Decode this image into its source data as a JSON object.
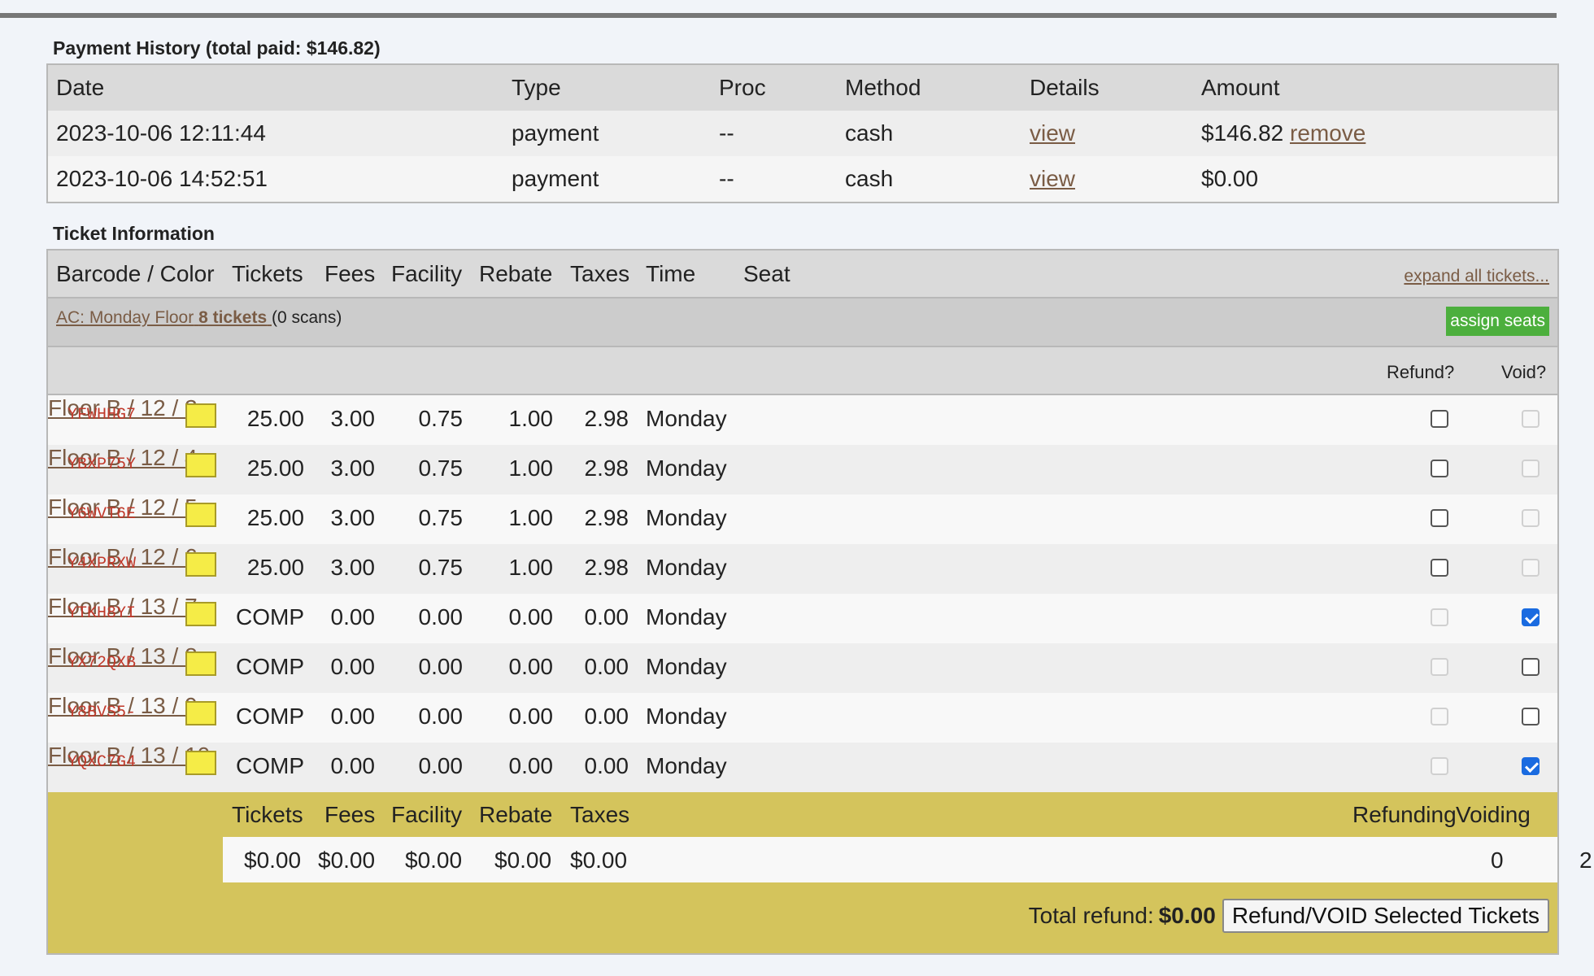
{
  "payment_history": {
    "title": "Payment History (total paid: $146.82)",
    "headers": [
      "Date",
      "Type",
      "Proc",
      "Method",
      "Details",
      "Amount"
    ],
    "rows": [
      {
        "date": "2023-10-06 12:11:44",
        "type": "payment",
        "proc": "--",
        "method": "cash",
        "details": "view",
        "amount": "$146.82",
        "action": "remove"
      },
      {
        "date": "2023-10-06 14:52:51",
        "type": "payment",
        "proc": "--",
        "method": "cash",
        "details": "view",
        "amount": "$0.00",
        "action": ""
      }
    ]
  },
  "ticket_info": {
    "title": "Ticket Information",
    "headers": [
      "Barcode / Color",
      "Tickets",
      "Fees",
      "Facility",
      "Rebate",
      "Taxes",
      "Time",
      "Seat"
    ],
    "expand_link": "expand all tickets...",
    "group": {
      "name": "AC: Monday Floor",
      "count": "8 tickets",
      "scans": "(0 scans)"
    },
    "assign_button": "assign seats",
    "refund_label": "Refund?",
    "void_label": "Void?",
    "swatch_color": "#f5ec47",
    "tickets": [
      {
        "barcode": "YFWHHG7",
        "tickets": "25.00",
        "fees": "3.00",
        "facility": "0.75",
        "rebate": "1.00",
        "taxes": "2.98",
        "time": "Monday",
        "seat": "Floor B / 12 / 3",
        "refund": "unchecked",
        "void": "disabled"
      },
      {
        "barcode": "YBXP75Y",
        "tickets": "25.00",
        "fees": "3.00",
        "facility": "0.75",
        "rebate": "1.00",
        "taxes": "2.98",
        "time": "Monday",
        "seat": "Floor B / 12 / 4",
        "refund": "unchecked",
        "void": "disabled"
      },
      {
        "barcode": "Y6WVT6E",
        "tickets": "25.00",
        "fees": "3.00",
        "facility": "0.75",
        "rebate": "1.00",
        "taxes": "2.98",
        "time": "Monday",
        "seat": "Floor B / 12 / 5",
        "refund": "unchecked",
        "void": "disabled"
      },
      {
        "barcode": "Y4XPRXW",
        "tickets": "25.00",
        "fees": "3.00",
        "facility": "0.75",
        "rebate": "1.00",
        "taxes": "2.98",
        "time": "Monday",
        "seat": "Floor B / 12 / 6",
        "refund": "unchecked",
        "void": "disabled"
      },
      {
        "barcode": "YTKH8YI",
        "tickets": "COMP",
        "fees": "0.00",
        "facility": "0.00",
        "rebate": "0.00",
        "taxes": "0.00",
        "time": "Monday",
        "seat": "Floor B / 13 / 7",
        "refund": "disabled",
        "void": "checked"
      },
      {
        "barcode": "YX72QXB",
        "tickets": "COMP",
        "fees": "0.00",
        "facility": "0.00",
        "rebate": "0.00",
        "taxes": "0.00",
        "time": "Monday",
        "seat": "Floor B / 13 / 8",
        "refund": "disabled",
        "void": "unchecked"
      },
      {
        "barcode": "Y8BVS5-",
        "tickets": "COMP",
        "fees": "0.00",
        "facility": "0.00",
        "rebate": "0.00",
        "taxes": "0.00",
        "time": "Monday",
        "seat": "Floor B / 13 / 9",
        "refund": "disabled",
        "void": "unchecked"
      },
      {
        "barcode": "YQXC7G4",
        "tickets": "COMP",
        "fees": "0.00",
        "facility": "0.00",
        "rebate": "0.00",
        "taxes": "0.00",
        "time": "Monday",
        "seat": "Floor B / 13 / 10",
        "refund": "disabled",
        "void": "checked"
      }
    ],
    "summary": {
      "headers": {
        "tickets": "Tickets",
        "fees": "Fees",
        "facility": "Facility",
        "rebate": "Rebate",
        "taxes": "Taxes",
        "refunding": "Refunding",
        "voiding": "Voiding"
      },
      "values": {
        "tickets": "$0.00",
        "fees": "$0.00",
        "facility": "$0.00",
        "rebate": "$0.00",
        "taxes": "$0.00",
        "refunding": "0",
        "voiding": "2"
      },
      "total_label": "Total refund:",
      "total_value": "$0.00",
      "button_label": "Refund/VOID Selected Tickets"
    }
  }
}
